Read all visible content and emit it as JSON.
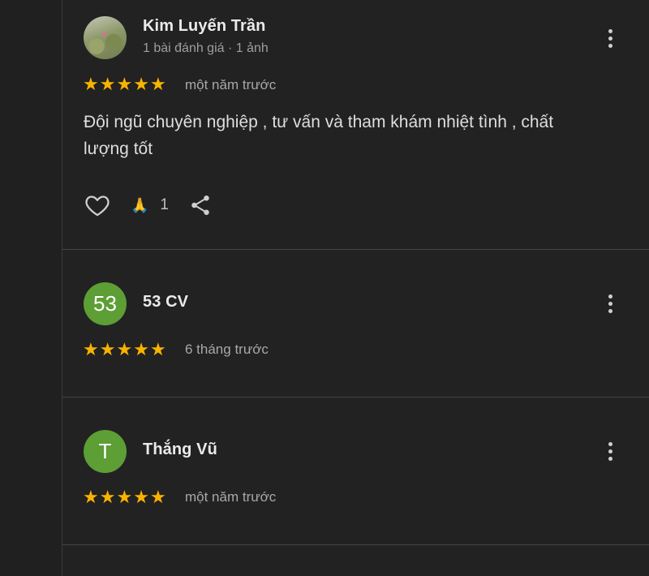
{
  "reviews": [
    {
      "name": "Kim Luyến Trần",
      "meta": "1 bài đánh giá · 1 ảnh",
      "time": "một năm trước",
      "text": "Đội ngũ chuyên nghiệp , tư vấn và tham khám nhiệt tình , chất lượng tốt",
      "reaction_emoji": "🙏",
      "reaction_count": "1",
      "rating": 5,
      "avatar": "photo"
    },
    {
      "name": "53 CV",
      "avatar_text": "53",
      "time": "6 tháng trước",
      "rating": 5,
      "avatar_color": "#5d9e35"
    },
    {
      "name": "Thắng Vũ",
      "avatar_text": "T",
      "time": "một năm trước",
      "rating": 5,
      "avatar_color": "#5d9e35"
    }
  ],
  "icons": {
    "star": "★",
    "like": "heart-outline-icon",
    "share": "share-icon",
    "more": "more-vertical-icon"
  },
  "colors": {
    "star": "#f9b300",
    "background": "#222222"
  }
}
